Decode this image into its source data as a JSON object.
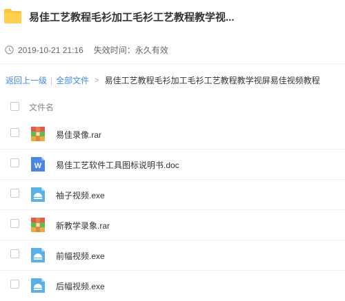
{
  "header": {
    "title": "易佳工艺教程毛衫加工毛衫工艺教程教学视...",
    "share_time": "2019-10-21 21:16",
    "expire_label": "失效时间：永久有效"
  },
  "breadcrumb": {
    "back_label": "返回上一级",
    "separator": "|",
    "all_files_label": "全部文件",
    "arrow": ">",
    "current": "易佳工艺教程毛衫加工毛衫工艺教程教学视屏易佳视频教程"
  },
  "list": {
    "column_label": "文件名",
    "files": [
      {
        "name": "易佳录像.rar",
        "icon": "rar-archive-icon"
      },
      {
        "name": "易佳工艺软件工具图标说明书.doc",
        "icon": "word-doc-icon"
      },
      {
        "name": "袖子视频.exe",
        "icon": "exe-file-icon"
      },
      {
        "name": "新教学录象.rar",
        "icon": "rar-archive-icon"
      },
      {
        "name": "前幅视频.exe",
        "icon": "exe-file-icon"
      },
      {
        "name": "后幅视频.exe",
        "icon": "exe-file-icon"
      }
    ]
  },
  "colors": {
    "link": "#3b8cff",
    "folder": "#ffc633",
    "word_blue": "#4a86e8",
    "exe_blue": "#5ab0e8"
  }
}
